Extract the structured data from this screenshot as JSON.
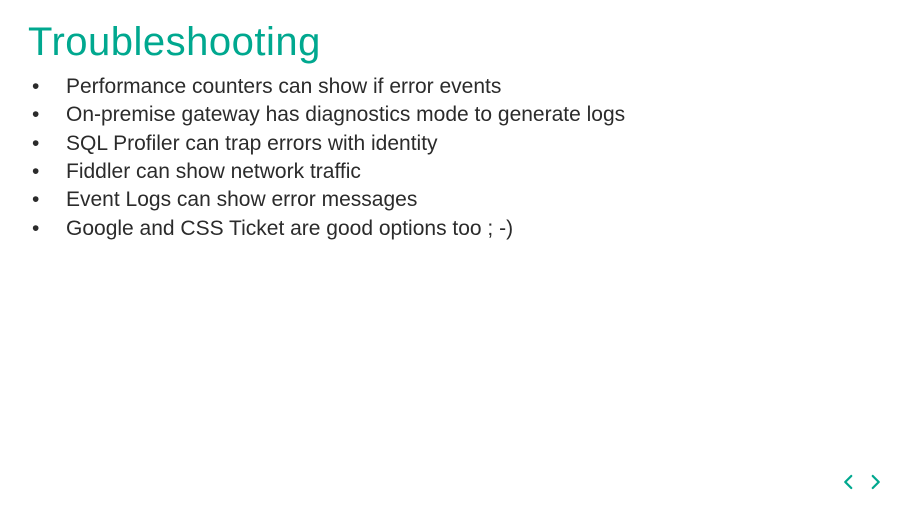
{
  "title": "Troubleshooting",
  "bullets": [
    "Performance counters can show if error events",
    "On-premise gateway has diagnostics mode to generate logs",
    "SQL Profiler can trap errors with identity",
    "Fiddler can show network traffic",
    "Event Logs can show error messages",
    "Google and CSS Ticket are good options too ; -)"
  ],
  "colors": {
    "accent": "#00a88f"
  }
}
